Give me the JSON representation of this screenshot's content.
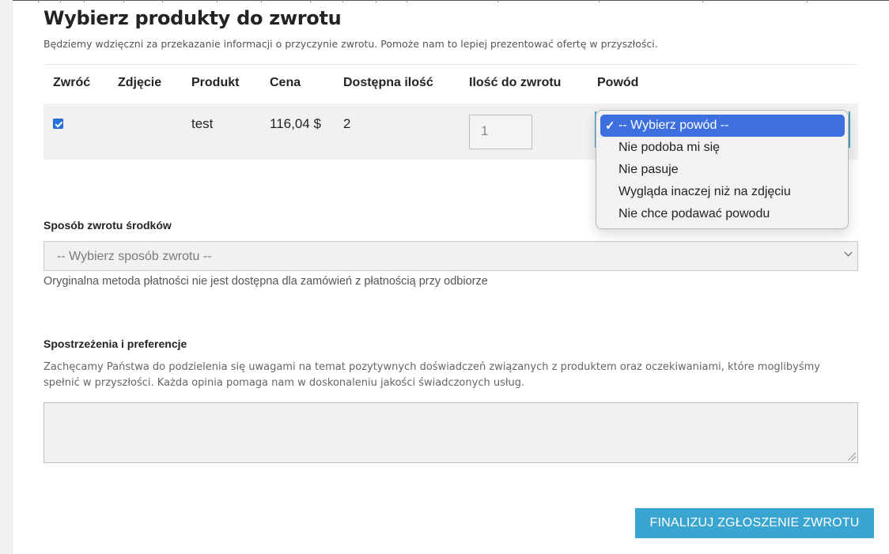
{
  "page": {
    "title": "Wybierz produkty do zwrotu",
    "subtitle": "Będziemy wdzięczni za przekazanie informacji o przyczynie zwrotu. Pomoże nam to lepiej prezentować ofertę w przyszłości."
  },
  "table": {
    "headers": [
      "Zwróć",
      "Zdjęcie",
      "Produkt",
      "Cena",
      "Dostępna ilość",
      "Ilość do zwrotu",
      "Powód"
    ],
    "rows": [
      {
        "checked": true,
        "product": "test",
        "price": "116,04 $",
        "available": "2",
        "quantity": "1"
      }
    ]
  },
  "reason_dropdown": {
    "options": [
      "-- Wybierz powód --",
      "Nie podoba mi się",
      "Nie pasuje",
      "Wygląda inaczej niż na zdjęciu",
      "Nie chce podawać powodu"
    ],
    "selected_index": 0
  },
  "refund": {
    "label": "Sposób zwrotu środków",
    "select_value": "-- Wybierz sposób zwrotu --",
    "help": "Oryginalna metoda płatności nie jest dostępna dla zamówień z płatnością przy odbiorze"
  },
  "feedback": {
    "label": "Spostrzeżenia i preferencje",
    "description": "Zachęcamy Państwa do podzielenia się uwagami na temat pozytywnych doświadczeń związanych z produktem oraz oczekiwaniami, które moglibyśmy spełnić w przyszłości. Każda opinia pomaga nam w doskonaleniu jakości świadczonych usług."
  },
  "submit": {
    "label": "FINALIZUJ ZGŁOSZENIE ZWROTU"
  },
  "colors": {
    "accent": "#3aa5d1",
    "selection": "#3d6fde",
    "checkbox": "#2a74e0"
  }
}
